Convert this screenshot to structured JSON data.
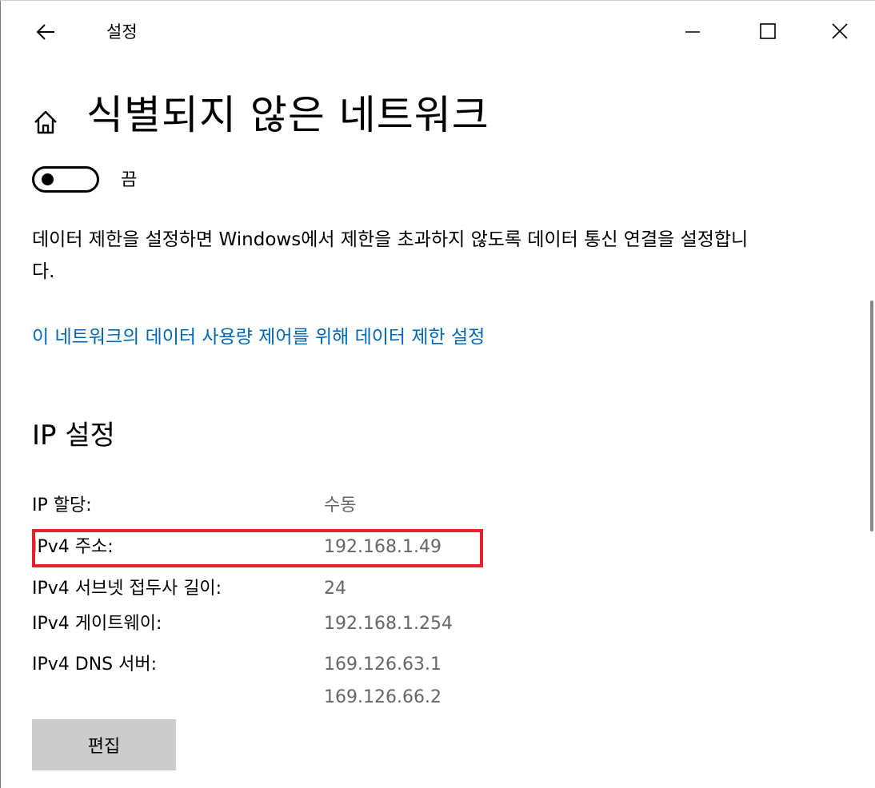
{
  "window": {
    "title": "설정",
    "back_icon": "arrow-left-icon",
    "minimize_icon": "minimize-icon",
    "maximize_icon": "maximize-icon",
    "close_icon": "close-icon"
  },
  "header": {
    "home_icon": "home-icon",
    "title": "식별되지 않은 네트워크"
  },
  "metered": {
    "toggle_state": "끔",
    "toggle_on": false,
    "description": "데이터 제한을 설정하면 Windows에서 제한을 초과하지 않도록 데이터 통신 연결을 설정합니다.",
    "link": "이 네트워크의 데이터 사용량 제어를 위해 데이터 제한 설정"
  },
  "ip_settings": {
    "title": "IP 설정",
    "rows": [
      {
        "label": "IP 할당:",
        "values": [
          "수동"
        ]
      },
      {
        "label": "IPv4 주소:",
        "values": [
          "192.168.1.49"
        ]
      },
      {
        "label": "IPv4 서브넷 접두사 길이:",
        "values": [
          "24"
        ]
      },
      {
        "label": "IPv4 게이트웨이:",
        "values": [
          "192.168.1.254"
        ]
      },
      {
        "label": "IPv4 DNS 서버:",
        "values": [
          "169.126.63.1",
          "169.126.66.2"
        ]
      }
    ],
    "edit_label": "편집"
  },
  "colors": {
    "link": "#0067b8",
    "value_text": "#666666",
    "highlight": "#e8202e",
    "button_bg": "#cccccc"
  }
}
